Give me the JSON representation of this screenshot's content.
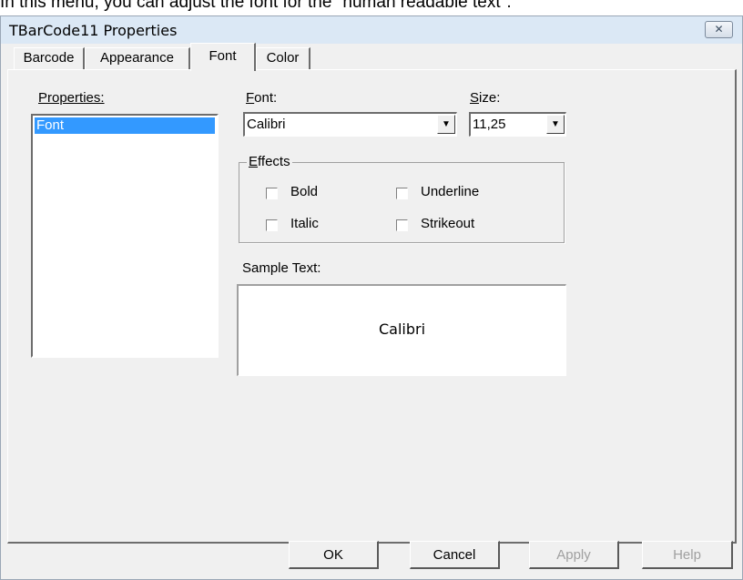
{
  "caption": "In this menu, you can adjust the font for the \"human readable text\".",
  "window": {
    "title": "TBarCode11 Properties",
    "close_glyph": "✕"
  },
  "tabs": [
    {
      "label": "Barcode"
    },
    {
      "label": "Appearance"
    },
    {
      "label": "Font",
      "active": true
    },
    {
      "label": "Color"
    }
  ],
  "properties": {
    "label": "Properties:",
    "items": [
      "Font"
    ],
    "selected": "Font"
  },
  "font": {
    "label_u": "F",
    "label_rest": "ont:",
    "value": "Calibri"
  },
  "size": {
    "label_u": "S",
    "label_rest": "ize:",
    "value": "11,25"
  },
  "effects": {
    "label_u": "E",
    "label_rest": "ffects",
    "options": [
      {
        "label": "Bold",
        "checked": false
      },
      {
        "label": "Underline",
        "checked": false
      },
      {
        "label": "Italic",
        "checked": false
      },
      {
        "label": "Strikeout",
        "checked": false
      }
    ]
  },
  "sample": {
    "label": "Sample Text:",
    "text": "Calibri"
  },
  "buttons": {
    "ok": "OK",
    "cancel": "Cancel",
    "apply": "Apply",
    "help": "Help"
  },
  "icons": {
    "dropdown": "chevron-down-icon",
    "close": "close-icon"
  }
}
